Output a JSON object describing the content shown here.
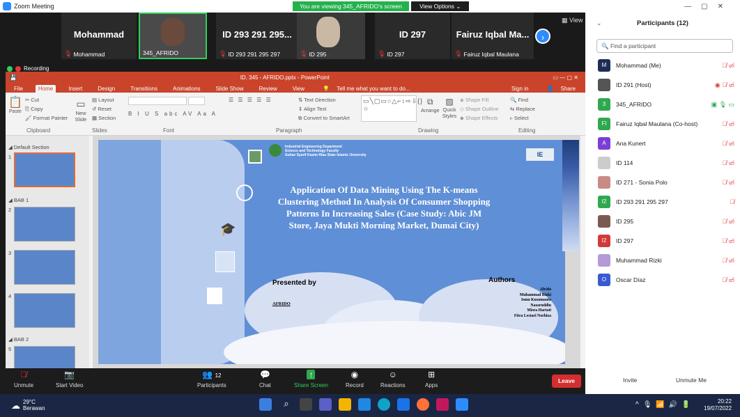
{
  "window": {
    "title": "Zoom Meeting",
    "viewing_banner": "You are viewing 345_AFRIDO's screen",
    "view_options": "View Options"
  },
  "thumbnails": [
    {
      "big_name": "Mohammad",
      "label": "Mohammad"
    },
    {
      "big_name": "",
      "label": "345_AFRIDO"
    },
    {
      "big_name": "ID 293 291 295...",
      "label": "ID 293 291 295 297"
    },
    {
      "big_name": "",
      "label": "ID 295"
    },
    {
      "big_name": "ID 297",
      "label": "ID 297"
    },
    {
      "big_name": "Fairuz Iqbal Ma...",
      "label": "Fairuz Iqbal Maulana"
    }
  ],
  "view_label": "View",
  "recording_label": "Recording",
  "ppt": {
    "title": "ID. 345 - AFRIDO.pptx - PowerPoint",
    "tabs": [
      "File",
      "Home",
      "Insert",
      "Design",
      "Transitions",
      "Animations",
      "Slide Show",
      "Review",
      "View"
    ],
    "tell_me": "Tell me what you want to do...",
    "sign_in": "Sign in",
    "share": "Share",
    "ribbon": {
      "cut": "Cut",
      "copy": "Copy",
      "format_painter": "Format Painter",
      "paste": "Paste",
      "layout": "Layout",
      "reset": "Reset",
      "section": "Section",
      "new_slide": "New Slide",
      "text_direction": "Text Direction",
      "align_text": "Align Text",
      "convert_smartart": "Convert to SmartArt",
      "arrange": "Arrange",
      "quick_styles": "Quick Styles",
      "shape_fill": "Shape Fill",
      "shape_outline": "Shape Outline",
      "shape_effects": "Shape Effects",
      "find": "Find",
      "replace": "Replace",
      "select": "Select",
      "groups": {
        "clipboard": "Clipboard",
        "slides": "Slides",
        "font": "Font",
        "paragraph": "Paragraph",
        "drawing": "Drawing",
        "editing": "Editing"
      }
    },
    "sections": [
      {
        "name": "Default Section",
        "slides": [
          "1"
        ]
      },
      {
        "name": "BAB 1",
        "slides": [
          "2",
          "3",
          "4"
        ]
      },
      {
        "name": "BAB 2",
        "slides": [
          "5"
        ]
      }
    ],
    "slide": {
      "dept_line1": "Industrial Engineering Department",
      "dept_line2": "Science and Technology Faculty",
      "dept_line3": "Sultan Syarif Kasim Riau State Islamic University",
      "title": "Application Of Data Mining Using The K-means Clustering Method In Analysis Of Consumer Shopping Patterns In Increasing Sales (Case Study: Abic JM Store, Jaya Mukti Morning Market, Dumai City)",
      "presented_by": "Presented by",
      "presenter": "AFRIDO",
      "authors_heading": "Authors",
      "authors": [
        "Afrido",
        "Muhammad Rizki",
        "Ismu Kusumanto",
        "Nazaruddin",
        "Misra Hartati",
        "Fitra Lestari Norhiza"
      ]
    }
  },
  "controls": [
    {
      "label": "Unmute"
    },
    {
      "label": "Start Video"
    },
    {
      "label": "Participants",
      "count": "12"
    },
    {
      "label": "Chat"
    },
    {
      "label": "Share Screen"
    },
    {
      "label": "Record"
    },
    {
      "label": "Reactions"
    },
    {
      "label": "Apps"
    }
  ],
  "leave": "Leave",
  "participants_panel": {
    "title": "Participants (12)",
    "search_placeholder": "Find a participant",
    "list": [
      {
        "initial": "M",
        "name": "Mohammad (Me)",
        "color": "#1f2d56"
      },
      {
        "initial": "",
        "name": "ID 291 (Host)",
        "color": "#555555"
      },
      {
        "initial": "3",
        "name": "345_AFRIDO",
        "color": "#2fa84f"
      },
      {
        "initial": "FI",
        "name": "Fairuz Iqbal Maulana (Co-host)",
        "color": "#2fa84f"
      },
      {
        "initial": "A",
        "name": "Ana Kunert",
        "color": "#7b3fd6"
      },
      {
        "initial": "",
        "name": "ID 114",
        "color": "#cccccc"
      },
      {
        "initial": "",
        "name": "ID 271 - Sonia Polo",
        "color": "#c98a86"
      },
      {
        "initial": "I2",
        "name": "ID 293 291 295 297",
        "color": "#2fa84f"
      },
      {
        "initial": "",
        "name": "ID 295",
        "color": "#7a5a50"
      },
      {
        "initial": "I2",
        "name": "ID 297",
        "color": "#d23a3a"
      },
      {
        "initial": "",
        "name": "Muhammad Rizki",
        "color": "#b49ad6"
      },
      {
        "initial": "O",
        "name": "Oscar Díaz",
        "color": "#3a5ad2"
      }
    ],
    "invite": "Invite",
    "unmute_me": "Unmute Me"
  },
  "taskbar": {
    "weather_temp": "29°C",
    "weather_desc": "Berawan",
    "time": "20:22",
    "date": "19/07/2022"
  }
}
